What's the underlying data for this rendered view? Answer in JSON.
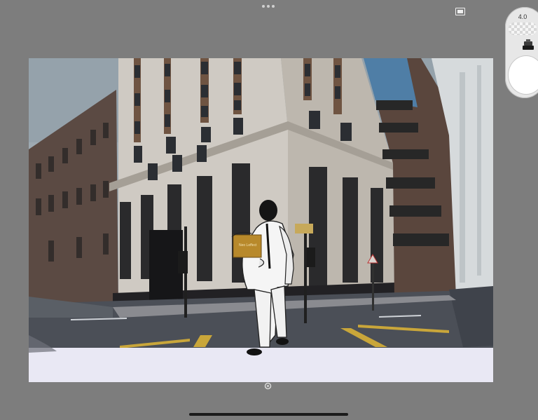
{
  "toolbar": {
    "more_icon": "more-dots-icon",
    "fullscreen_icon": "fullscreen-icon"
  },
  "brush_panel": {
    "size_value": "4.0",
    "size_icon": "brush-size-slider",
    "tip_icon": "brush-tip-icon",
    "opacity_icon": "opacity-slider"
  },
  "canvas": {
    "description_icon": "drawing-canvas",
    "sign_text": "Neo Leffect"
  },
  "bottom": {
    "handle_icon": "canvas-rotate-handle-icon",
    "home_indicator": "home-indicator"
  },
  "colors": {
    "background": "#7d7d7d",
    "panel": "#e7e7e7",
    "canvas_bottom": "#e9e8f4"
  }
}
